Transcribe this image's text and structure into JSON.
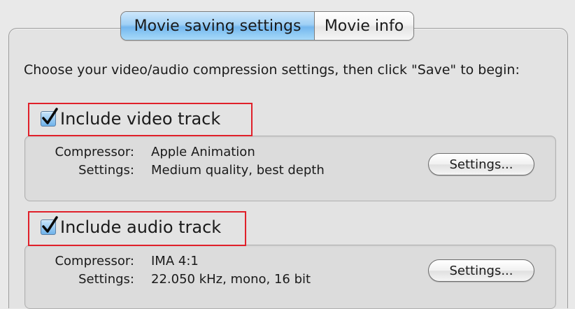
{
  "tabs": [
    {
      "label": "Movie saving settings",
      "active": true
    },
    {
      "label": "Movie info",
      "active": false
    }
  ],
  "instruction": "Choose your video/audio compression settings, then click \"Save\" to begin:",
  "video": {
    "checkbox_label": "Include video track",
    "checked": true,
    "compressor_label": "Compressor:",
    "compressor_value": "Apple Animation",
    "settings_label": "Settings:",
    "settings_value": "Medium quality, best depth",
    "settings_button": "Settings..."
  },
  "audio": {
    "checkbox_label": "Include audio track",
    "checked": true,
    "compressor_label": "Compressor:",
    "compressor_value": "IMA 4:1",
    "settings_label": "Settings:",
    "settings_value": "22.050 kHz, mono, 16 bit",
    "settings_button": "Settings..."
  },
  "colors": {
    "accent_tab": "#9fd0f5",
    "highlight": "#e0202a",
    "panel_bg": "#e3e3e3"
  },
  "icons": {
    "checkbox": "checkmark-icon"
  }
}
